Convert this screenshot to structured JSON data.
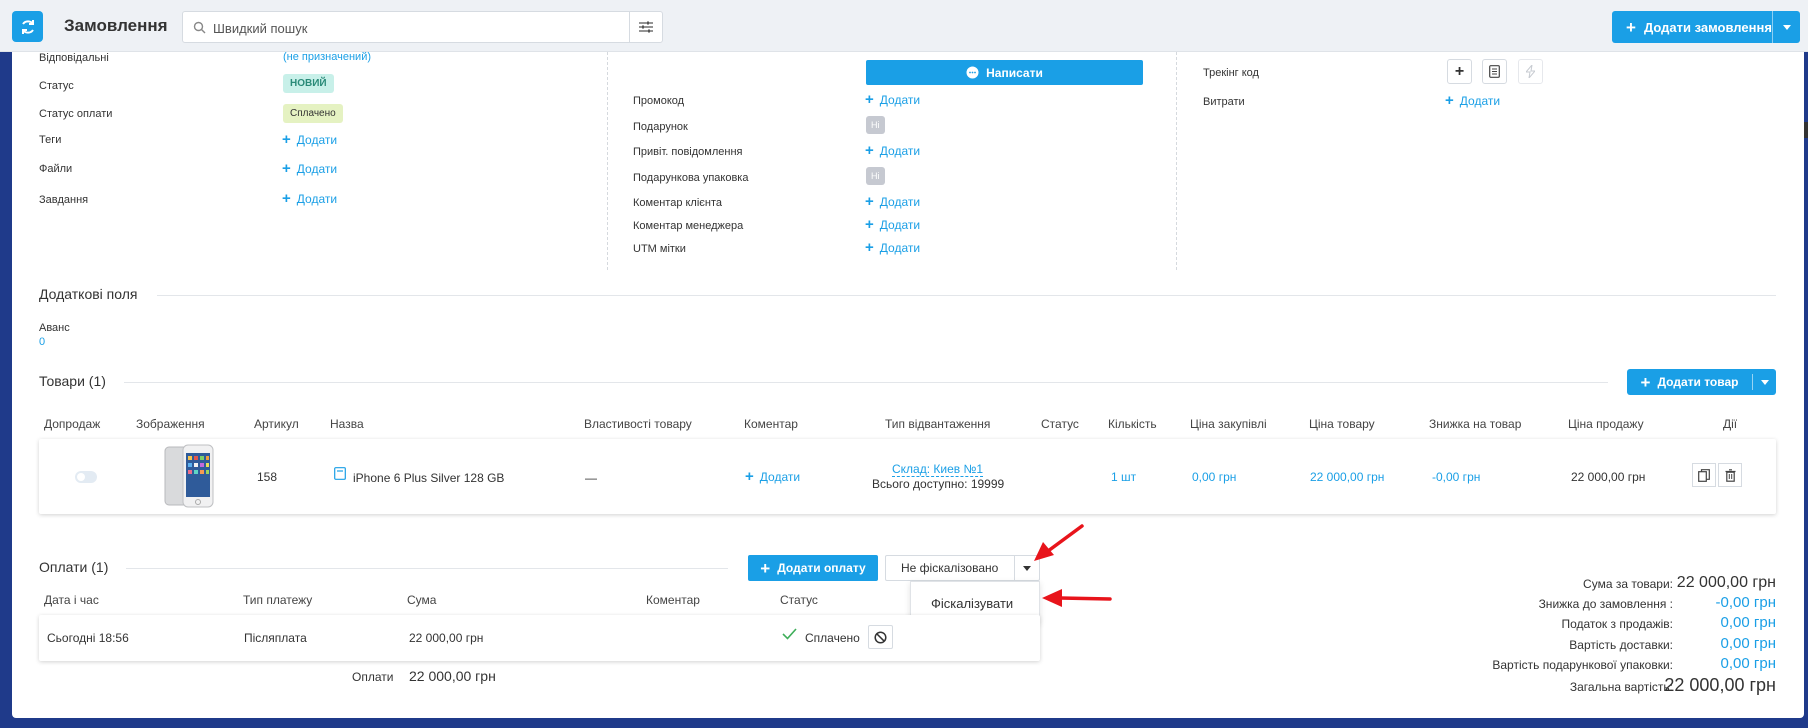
{
  "header": {
    "title": "Замовлення",
    "search_placeholder": "Швидкий пошук",
    "add_order_label": "Додати замовлення"
  },
  "details_left": {
    "responsible_label": "Відповідальні",
    "responsible_value": "(не призначений)",
    "status_label": "Статус",
    "status_value": "НОВИЙ",
    "payment_status_label": "Статус оплати",
    "payment_status_value": "Сплачено",
    "tags_label": "Теги",
    "files_label": "Файли",
    "tasks_label": "Завдання",
    "add_label": "Додати"
  },
  "details_mid": {
    "write_label": "Написати",
    "promocode_label": "Промокод",
    "gift_label": "Подарунок",
    "gift_value": "Ні",
    "greeting_label": "Привіт. повідомлення",
    "gift_wrap_label": "Подарункова упаковка",
    "gift_wrap_value": "Ні",
    "client_comment_label": "Коментар клієнта",
    "manager_comment_label": "Коментар менеджера",
    "utm_label": "UTM мітки",
    "add_label": "Додати"
  },
  "details_right": {
    "tracking_label": "Трекінг код",
    "expenses_label": "Витрати",
    "add_label": "Додати"
  },
  "extra_fields": {
    "title": "Додаткові поля",
    "advance_label": "Аванс",
    "advance_value": "0"
  },
  "goods": {
    "title": "Товари (1)",
    "add_label": "Додати товар",
    "columns": [
      "Допродаж",
      "Зображення",
      "Артикул",
      "Назва",
      "Властивості товару",
      "Коментар",
      "Тип відвантаження",
      "Статус",
      "Кількість",
      "Ціна закупівлі",
      "Ціна товару",
      "Знижка на товар",
      "Ціна продажу",
      "Дії"
    ],
    "row": {
      "sku": "158",
      "name": "iPhone 6 Plus Silver 128 GB",
      "properties": "—",
      "comment_add": "Додати",
      "shipment_link": "Склад: Киев №1",
      "shipment_available": "Всього доступно: 19999",
      "quantity": "1 шт",
      "purchase_price": "0,00 грн",
      "item_price": "22 000,00 грн",
      "discount": "-0,00 грн",
      "sale_price": "22 000,00 грн"
    }
  },
  "payments": {
    "title": "Оплати (1)",
    "add_label": "Додати оплату",
    "fiscal_select": "Не фіскалізовано",
    "dropdown_item": "Фіскалізувати",
    "columns": [
      "Дата і час",
      "Тип платежу",
      "Сума",
      "Коментар",
      "Статус"
    ],
    "row": {
      "datetime": "Сьогодні 18:56",
      "type": "Післяплата",
      "amount": "22 000,00 грн",
      "status": "Сплачено"
    },
    "total_label": "Оплати",
    "total_value": "22 000,00 грн"
  },
  "summary": {
    "goods_sum_label": "Сума за товари:",
    "goods_sum_value": "22 000,00 грн",
    "order_discount_label": "Знижка до замовлення :",
    "order_discount_value": "-0,00 грн",
    "sales_tax_label": "Податок з продажів:",
    "sales_tax_value": "0,00 грн",
    "delivery_label": "Вартість доставки:",
    "delivery_value": "0,00 грн",
    "gift_wrap_label": "Вартість подарункової упаковки:",
    "gift_wrap_value": "0,00 грн",
    "total_label": "Загальна вартість:",
    "total_value": "22 000,00 грн"
  },
  "colors": {
    "accent": "#1a9fe6",
    "arrow": "#e8141b"
  }
}
